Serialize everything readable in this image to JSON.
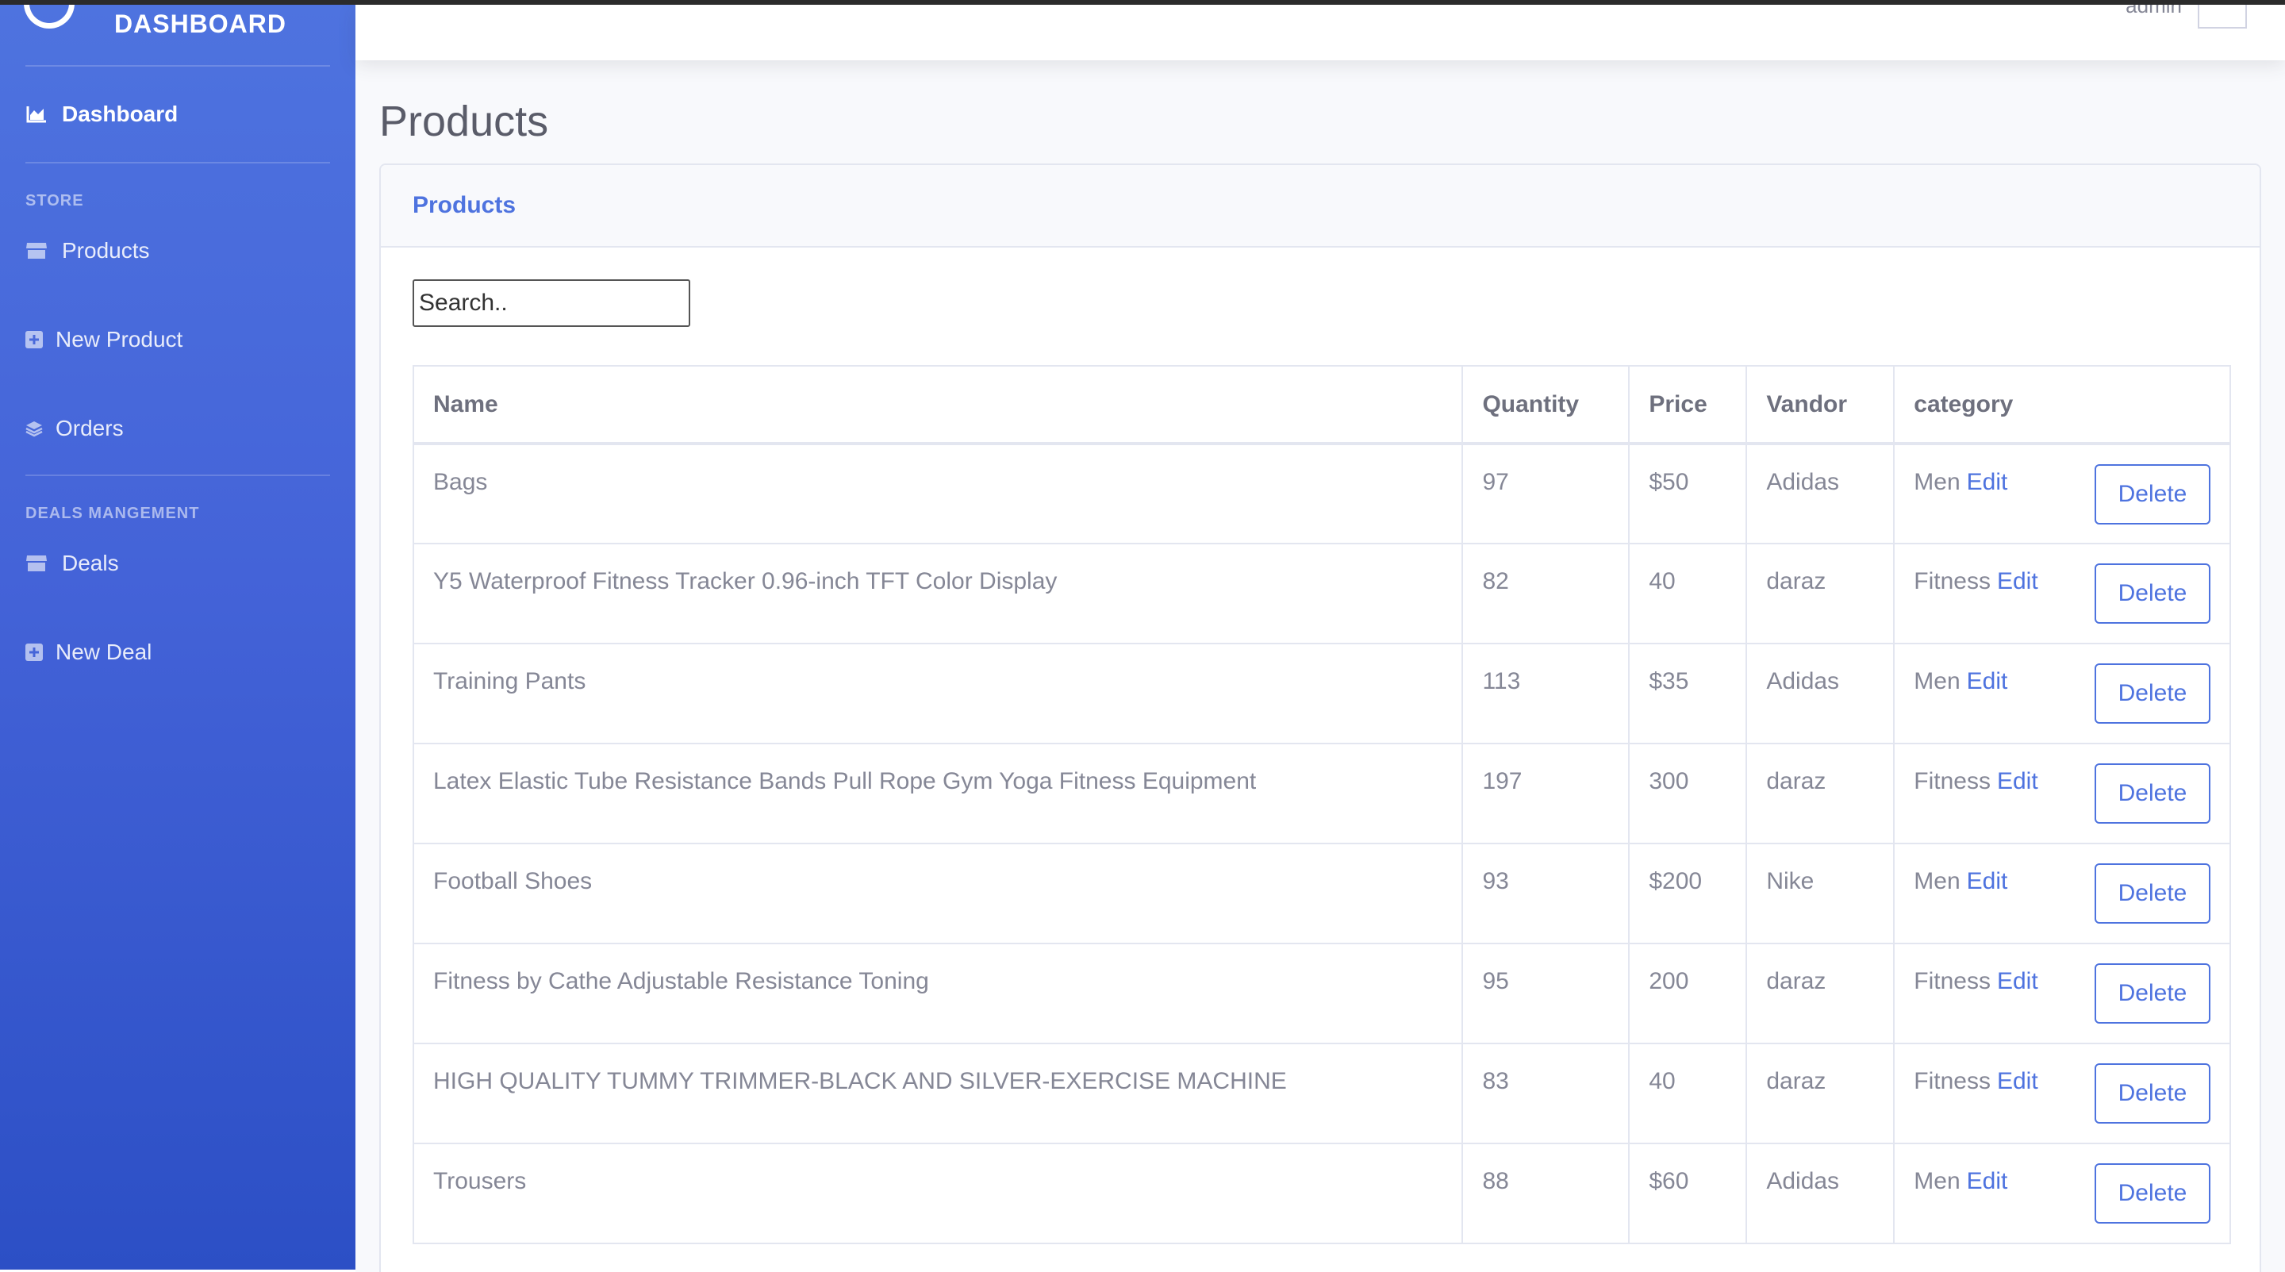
{
  "sidebar": {
    "brand": "DASHBOARD",
    "dashboard_label": "Dashboard",
    "store_heading": "STORE",
    "products_label": "Products",
    "new_product_label": "New Product",
    "orders_label": "Orders",
    "deals_heading": "DEALS MANGEMENT",
    "deals_label": "Deals",
    "new_deal_label": "New Deal"
  },
  "topbar": {
    "user_name": "admin"
  },
  "page": {
    "title": "Products"
  },
  "card": {
    "title": "Products",
    "search_placeholder": "Search.."
  },
  "table": {
    "headers": {
      "name": "Name",
      "quantity": "Quantity",
      "price": "Price",
      "vendor": "Vandor",
      "category": "category"
    },
    "edit_label": "Edit",
    "delete_label": "Delete",
    "rows": [
      {
        "name": "Bags",
        "quantity": "97",
        "price": "$50",
        "vendor": "Adidas",
        "category": "Men"
      },
      {
        "name": "Y5 Waterproof Fitness Tracker 0.96-inch TFT Color Display",
        "quantity": "82",
        "price": "40",
        "vendor": "daraz",
        "category": "Fitness"
      },
      {
        "name": "Training Pants",
        "quantity": "113",
        "price": "$35",
        "vendor": "Adidas",
        "category": "Men"
      },
      {
        "name": "Latex Elastic Tube Resistance Bands Pull Rope Gym Yoga Fitness Equipment",
        "quantity": "197",
        "price": "300",
        "vendor": "daraz",
        "category": "Fitness"
      },
      {
        "name": "Football Shoes",
        "quantity": "93",
        "price": "$200",
        "vendor": "Nike",
        "category": "Men"
      },
      {
        "name": "Fitness by Cathe Adjustable Resistance Toning",
        "quantity": "95",
        "price": "200",
        "vendor": "daraz",
        "category": "Fitness"
      },
      {
        "name": "HIGH QUALITY TUMMY TRIMMER-BLACK AND SILVER-EXERCISE MACHINE",
        "quantity": "83",
        "price": "40",
        "vendor": "daraz",
        "category": "Fitness"
      },
      {
        "name": "Trousers",
        "quantity": "88",
        "price": "$60",
        "vendor": "Adidas",
        "category": "Men"
      }
    ]
  },
  "colors": {
    "primary": "#4e73df",
    "sidebar_top": "#4e73df",
    "sidebar_bottom": "#2c4fc5",
    "text_gray": "#858796"
  }
}
